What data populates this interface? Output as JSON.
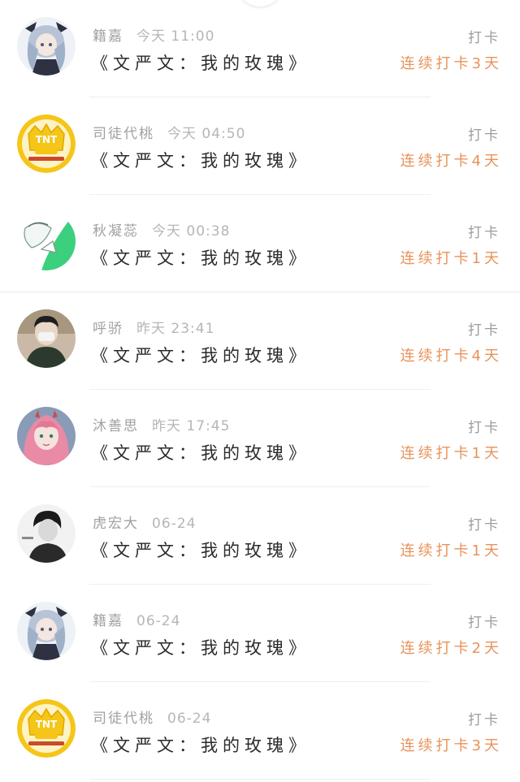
{
  "colors": {
    "accent": "#e8935a",
    "name_text": "#a0a0a0",
    "title_text": "#2a2a2a",
    "tnt_yellow": "#f5c518"
  },
  "checkins": [
    {
      "username": "籍嘉",
      "time": "今天 11:00",
      "work_title": "《文严文：我的玫瑰》",
      "checkin_label": "打卡",
      "streak": "连续打卡3天",
      "avatar_icon": "anime-girl-blue-hair-avatar"
    },
    {
      "username": "司徒代桃",
      "time": "今天 04:50",
      "work_title": "《文严文：我的玫瑰》",
      "checkin_label": "打卡",
      "streak": "连续打卡4天",
      "avatar_icon": "tnt-logo-avatar"
    },
    {
      "username": "秋凝蕊",
      "time": "今天 00:38",
      "work_title": "《文严文：我的玫瑰》",
      "checkin_label": "打卡",
      "streak": "连续打卡1天",
      "avatar_icon": "green-anime-sketch-avatar"
    },
    {
      "username": "呼骄",
      "time": "昨天 23:41",
      "work_title": "《文严文：我的玫瑰》",
      "checkin_label": "打卡",
      "streak": "连续打卡4天",
      "avatar_icon": "masked-person-avatar"
    },
    {
      "username": "沐善思",
      "time": "昨天 17:45",
      "work_title": "《文严文：我的玫瑰》",
      "checkin_label": "打卡",
      "streak": "连续打卡1天",
      "avatar_icon": "pink-hair-anime-avatar"
    },
    {
      "username": "虎宏大",
      "time": "06-24",
      "work_title": "《文严文：我的玫瑰》",
      "checkin_label": "打卡",
      "streak": "连续打卡1天",
      "avatar_icon": "bw-portrait-avatar"
    },
    {
      "username": "籍嘉",
      "time": "06-24",
      "work_title": "《文严文：我的玫瑰》",
      "checkin_label": "打卡",
      "streak": "连续打卡2天",
      "avatar_icon": "anime-girl-blue-hair-avatar"
    },
    {
      "username": "司徒代桃",
      "time": "06-24",
      "work_title": "《文严文：我的玫瑰》",
      "checkin_label": "打卡",
      "streak": "连续打卡3天",
      "avatar_icon": "tnt-logo-avatar"
    }
  ]
}
